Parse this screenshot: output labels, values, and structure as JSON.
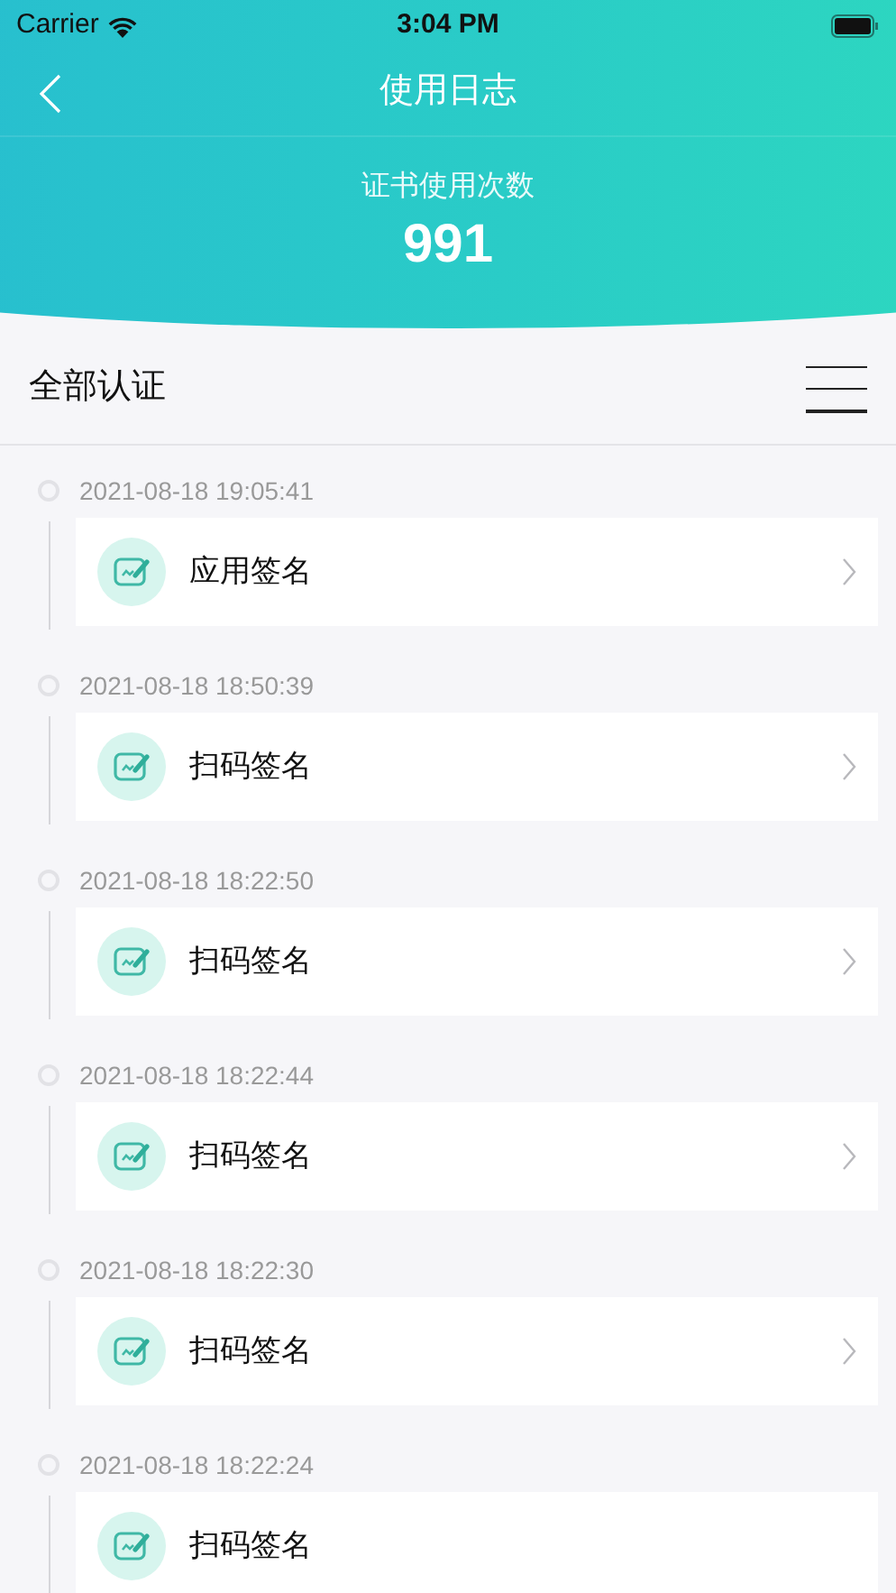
{
  "status_bar": {
    "carrier": "Carrier",
    "time": "3:04 PM"
  },
  "nav": {
    "title": "使用日志"
  },
  "summary": {
    "label": "证书使用次数",
    "count": "991"
  },
  "filter": {
    "label": "全部认证"
  },
  "entries": [
    {
      "time": "2021-08-18 19:05:41",
      "title": "应用签名",
      "chevron": true
    },
    {
      "time": "2021-08-18 18:50:39",
      "title": "扫码签名",
      "chevron": true
    },
    {
      "time": "2021-08-18 18:22:50",
      "title": "扫码签名",
      "chevron": true
    },
    {
      "time": "2021-08-18 18:22:44",
      "title": "扫码签名",
      "chevron": true
    },
    {
      "time": "2021-08-18 18:22:30",
      "title": "扫码签名",
      "chevron": true
    },
    {
      "time": "2021-08-18 18:22:24",
      "title": "扫码签名",
      "chevron": false
    }
  ]
}
